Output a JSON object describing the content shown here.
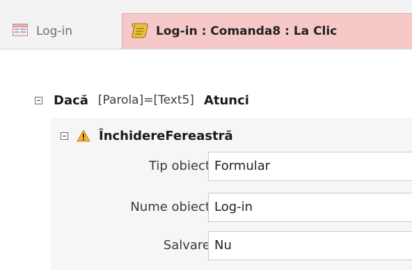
{
  "tabs": [
    {
      "label": "Log-in",
      "icon": "form-icon",
      "active": false
    },
    {
      "label": "Log-in : Comanda8 : La Clic",
      "icon": "macro-scroll-icon",
      "active": true
    }
  ],
  "colors": {
    "active_tab": "#f7c8c8",
    "tab_strip": "#f3f3f3",
    "action_block": "#f6f6f6",
    "warning": "#f2b23a"
  },
  "macro": {
    "if_keyword": "Dacă",
    "condition": "[Parola]=[Text5]",
    "then_keyword": "Atunci",
    "action": {
      "name": "ÎnchidereFereastră",
      "icon": "warning-icon",
      "arguments": [
        {
          "label": "Tip obiect",
          "value": "Formular"
        },
        {
          "label": "Nume obiect",
          "value": "Log-in"
        },
        {
          "label": "Salvare",
          "value": "Nu"
        }
      ]
    }
  }
}
